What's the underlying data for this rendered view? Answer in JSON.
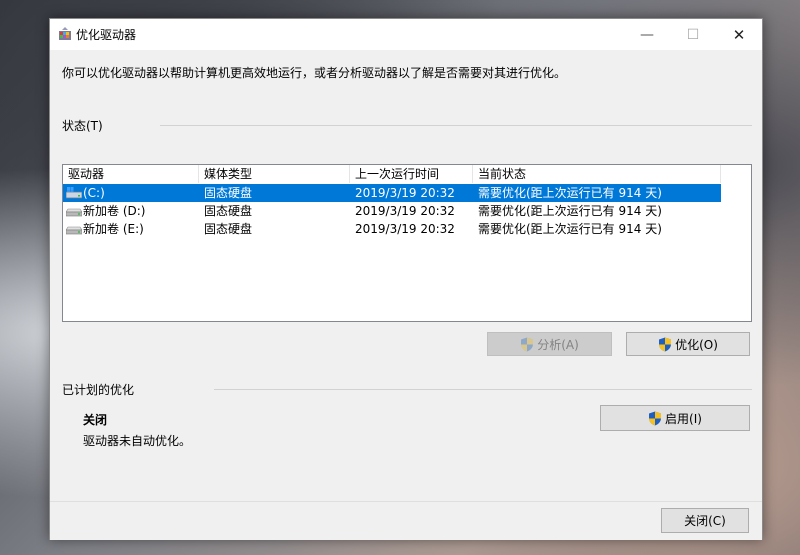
{
  "window": {
    "title": "优化驱动器",
    "controls": {
      "minimize": "—",
      "maximize": "☐",
      "close": "✕"
    }
  },
  "intro_text": "你可以优化驱动器以帮助计算机更高效地运行，或者分析驱动器以了解是否需要对其进行优化。",
  "status_section": {
    "label": "状态(T)",
    "columns": [
      "驱动器",
      "媒体类型",
      "上一次运行时间",
      "当前状态"
    ],
    "rows": [
      {
        "drive": "(C:)",
        "media": "固态硬盘",
        "last_run": "2019/3/19 20:32",
        "status": "需要优化(距上次运行已有 914 天)",
        "icon": "windows-drive-icon",
        "selected": true
      },
      {
        "drive": "新加卷 (D:)",
        "media": "固态硬盘",
        "last_run": "2019/3/19 20:32",
        "status": "需要优化(距上次运行已有 914 天)",
        "icon": "drive-icon",
        "selected": false
      },
      {
        "drive": "新加卷 (E:)",
        "media": "固态硬盘",
        "last_run": "2019/3/19 20:32",
        "status": "需要优化(距上次运行已有 914 天)",
        "icon": "drive-icon",
        "selected": false
      }
    ]
  },
  "buttons": {
    "analyze": "分析(A)",
    "optimize": "优化(O)",
    "enable": "启用(I)",
    "close": "关闭(C)"
  },
  "scheduled_section": {
    "label": "已计划的优化",
    "state": "关闭",
    "description": "驱动器未自动优化。"
  },
  "colors": {
    "selection": "#0078d7",
    "shield_blue": "#1f5fbf",
    "shield_yellow": "#f6c223"
  }
}
